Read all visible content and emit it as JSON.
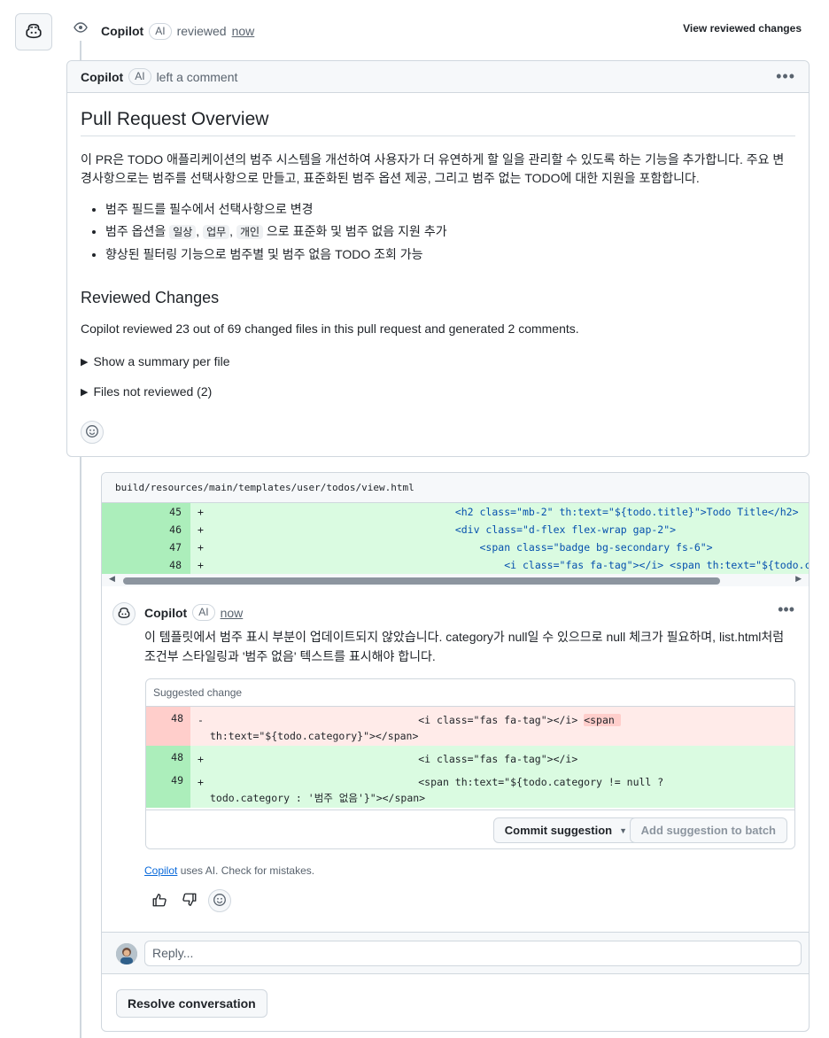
{
  "header": {
    "author": "Copilot",
    "ai_badge": "AI",
    "action": "reviewed",
    "time": "now",
    "view_changes": "View reviewed changes"
  },
  "review": {
    "author": "Copilot",
    "ai_badge": "AI",
    "action": "left a comment",
    "title": "Pull Request Overview",
    "intro": "이 PR은 TODO 애플리케이션의 범주 시스템을 개선하여 사용자가 더 유연하게 할 일을 관리할 수 있도록 하는 기능을 추가합니다. 주요 변경사항으로는 범주를 선택사항으로 만들고, 표준화된 범주 옵션 제공, 그리고 범주 없는 TODO에 대한 지원을 포함합니다.",
    "bullet_1": "범주 필드를 필수에서 선택사항으로 변경",
    "bullet_2_prefix": "범주 옵션을",
    "bullet_2_code_1": "일상",
    "bullet_2_code_2": "업무",
    "bullet_2_code_3": "개인",
    "bullet_2_suffix": "으로 표준화 및 범주 없음 지원 추가",
    "bullet_3": "향상된 필터링 기능으로 범주별 및 범주 없음 TODO 조회 가능",
    "section_title": "Reviewed Changes",
    "summary": "Copilot reviewed 23 out of 69 changed files in this pull request and generated 2 comments.",
    "details_1": "Show a summary per file",
    "details_2": "Files not reviewed (2)"
  },
  "diff": {
    "file_path": "build/resources/main/templates/user/todos/view.html",
    "lines": [
      {
        "num": "45",
        "sign": "+",
        "indent": "                                         ",
        "code": "<h2 class=\"mb-2\" th:text=\"${todo.title}\">Todo Title</h2>"
      },
      {
        "num": "46",
        "sign": "+",
        "indent": "                                         ",
        "code": "<div class=\"d-flex flex-wrap gap-2\">"
      },
      {
        "num": "47",
        "sign": "+",
        "indent": "                                             ",
        "code": "<span class=\"badge bg-secondary fs-6\">"
      },
      {
        "num": "48",
        "sign": "+",
        "indent": "                                                 ",
        "code": "<i class=\"fas fa-tag\"></i> <span th:text=\"${todo.catego"
      }
    ]
  },
  "comment": {
    "author": "Copilot",
    "ai_badge": "AI",
    "time": "now",
    "body": "이 템플릿에서 범주 표시 부분이 업데이트되지 않았습니다. category가 null일 수 있으므로 null 체크가 필요하며, list.html처럼 조건부 스타일링과 '범주 없음' 텍스트를 표시해야 합니다.",
    "suggested_label": "Suggested change",
    "del_num": "48",
    "del_line_1": "-                                   <i class=\"fas fa-tag\"></i> ",
    "del_line_1_hl": "<span ",
    "del_line_2": "th:text=\"${todo.category}\"></span>",
    "add_1_num": "48",
    "add_1": "+                                   <i class=\"fas fa-tag\"></i>",
    "add_2_num": "49",
    "add_2_line_1": "+                                   <span th:text=\"${todo.category != null ?",
    "add_2_line_2": "todo.category : '범주 없음'}\"></span>",
    "commit_button": "Commit suggestion",
    "batch_button": "Add suggestion to batch",
    "ai_note_link": "Copilot",
    "ai_note_rest": " uses AI. Check for mistakes."
  },
  "reply": {
    "placeholder": "Reply..."
  },
  "resolve_button": "Resolve conversation",
  "colors": {
    "add_bg": "#dafbe1",
    "add_num_bg": "#aceebb",
    "del_bg": "#ffebe9",
    "del_num_bg": "#ffcecb",
    "border": "#d0d7de",
    "link": "#0969da"
  },
  "icons": {
    "copilot": "copilot-icon",
    "eye": "eye-icon",
    "kebab": "kebab-horizontal-icon",
    "smiley": "smiley-icon",
    "thumbs_up": "thumbs-up-icon",
    "thumbs_down": "thumbs-down-icon",
    "caret_down": "triangle-down-icon"
  }
}
